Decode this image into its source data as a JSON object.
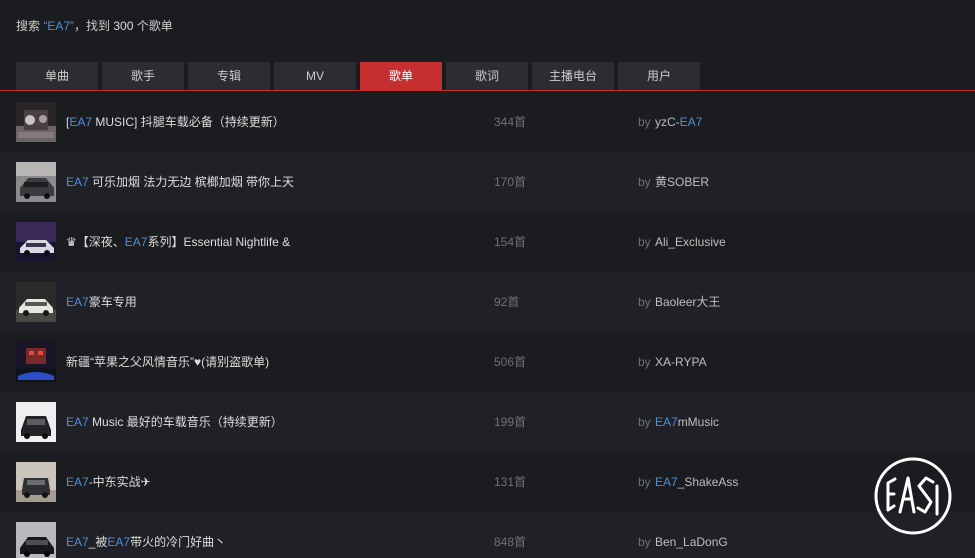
{
  "search": {
    "prefix": "搜索 ",
    "keyword": "“EA7”",
    "middle": "，找到 ",
    "count": "300",
    "suffix": " 个歌单"
  },
  "tabs": [
    {
      "label": "单曲",
      "active": false
    },
    {
      "label": "歌手",
      "active": false
    },
    {
      "label": "专辑",
      "active": false
    },
    {
      "label": "MV",
      "active": false
    },
    {
      "label": "歌单",
      "active": true
    },
    {
      "label": "歌词",
      "active": false
    },
    {
      "label": "主播电台",
      "active": false
    },
    {
      "label": "用户",
      "active": false
    }
  ],
  "by_label": "by",
  "playlists": [
    {
      "title": [
        [
          "[",
          false
        ],
        [
          "EA7",
          true
        ],
        [
          " MUSIC] 抖腿车载必备（持续更新）",
          false
        ]
      ],
      "tracks": "344首",
      "creator": [
        [
          "yzC-",
          false
        ],
        [
          "EA7",
          true
        ]
      ]
    },
    {
      "title": [
        [
          "EA7",
          true
        ],
        [
          " 可乐加烟 法力无边 槟榔加烟 带你上天",
          false
        ]
      ],
      "tracks": "170首",
      "creator": [
        [
          "黄SOBER",
          false
        ]
      ]
    },
    {
      "title": [
        [
          "♛【深夜、",
          false
        ],
        [
          "EA7",
          true
        ],
        [
          "系列】Essential Nightlife &",
          false
        ]
      ],
      "tracks": "154首",
      "creator": [
        [
          "Ali_Exclusive",
          false
        ]
      ]
    },
    {
      "title": [
        [
          "EA7",
          true
        ],
        [
          "豪车专用",
          false
        ]
      ],
      "tracks": "92首",
      "creator": [
        [
          "Baoleer大王",
          false
        ]
      ]
    },
    {
      "title": [
        [
          "新疆“苹果之父风情音乐”♥(请别盗歌单)",
          false
        ]
      ],
      "tracks": "506首",
      "creator": [
        [
          "XA-RYPA",
          false
        ]
      ]
    },
    {
      "title": [
        [
          "EA7",
          true
        ],
        [
          " Music 最好的车载音乐（持续更新）",
          false
        ]
      ],
      "tracks": "199首",
      "creator": [
        [
          "EA7",
          true
        ],
        [
          "mMusic",
          false
        ]
      ]
    },
    {
      "title": [
        [
          "EA7",
          true
        ],
        [
          "-中东实战✈",
          false
        ]
      ],
      "tracks": "131首",
      "creator": [
        [
          "EA7",
          true
        ],
        [
          "_ShakeAss",
          false
        ]
      ]
    },
    {
      "title": [
        [
          "EA7",
          true
        ],
        [
          "_被",
          false
        ],
        [
          "EA7",
          true
        ],
        [
          "带火的冷门好曲丶",
          false
        ]
      ],
      "tracks": "848首",
      "creator": [
        [
          "Ben_LaDonG",
          false
        ]
      ]
    }
  ],
  "colors": {
    "accent": "#c62f2f",
    "highlight": "#4f8fd6",
    "background": "#1b1c20"
  },
  "icons": {
    "watermark": "eas-logo"
  }
}
